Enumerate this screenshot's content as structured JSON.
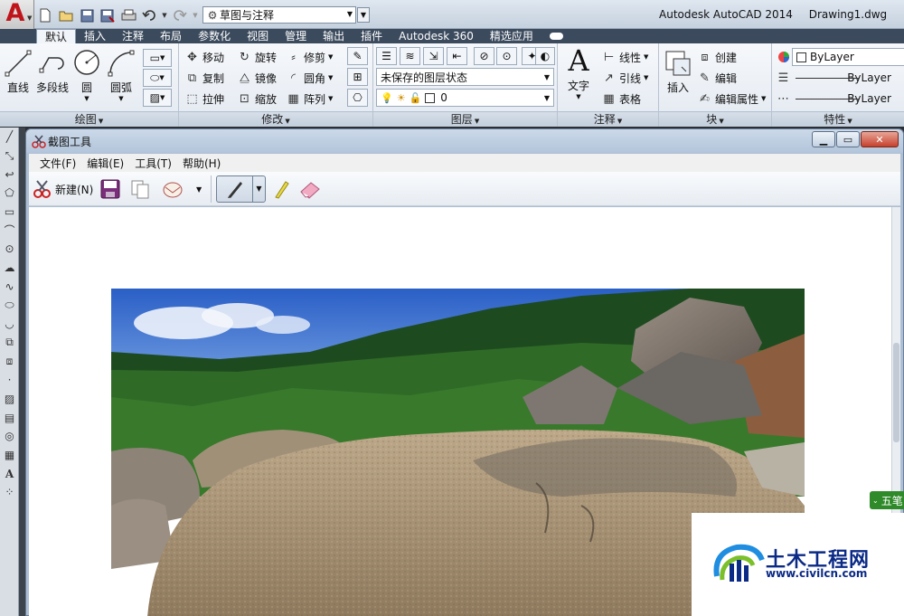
{
  "autocad": {
    "workspace": "草图与注释",
    "product": "Autodesk AutoCAD 2014",
    "document": "Drawing1.dwg",
    "tabs": [
      "默认",
      "插入",
      "注释",
      "布局",
      "参数化",
      "视图",
      "管理",
      "输出",
      "插件",
      "Autodesk 360",
      "精选应用"
    ],
    "panels": {
      "draw": {
        "title": "绘图",
        "line": "直线",
        "polyline": "多段线",
        "circle": "圆",
        "arc": "圆弧"
      },
      "modify": {
        "title": "修改",
        "move": "移动",
        "rotate": "旋转",
        "trim": "修剪",
        "copy": "复制",
        "mirror": "镜像",
        "fillet": "圆角",
        "stretch": "拉伸",
        "scale": "缩放",
        "array": "阵列"
      },
      "layers": {
        "title": "图层",
        "state": "未保存的图层状态",
        "current": "0"
      },
      "annotation": {
        "title": "注释",
        "text": "文字",
        "linear": "线性",
        "leader": "引线",
        "table": "表格"
      },
      "block": {
        "title": "块",
        "insert": "插入",
        "create": "创建",
        "edit": "编辑",
        "edit_attrs": "编辑属性"
      },
      "properties": {
        "title": "特性",
        "color": "ByLayer",
        "linetype": "ByLayer",
        "lineweight": "ByLayer"
      }
    }
  },
  "snip": {
    "title": "截图工具",
    "menu": [
      "文件(F)",
      "编辑(E)",
      "工具(T)",
      "帮助(H)"
    ],
    "new_label": "新建(N)"
  },
  "overlay": {
    "ime": "五笔",
    "watermark_title": "土木工程网",
    "watermark_url": "www.civilcn.com"
  },
  "colors": {
    "autocad_red": "#c0141b",
    "ribbon_tab_bg": "#3b4a5d",
    "watermark_blue": "#0b2a86",
    "ime_green": "#2f8a2a"
  }
}
